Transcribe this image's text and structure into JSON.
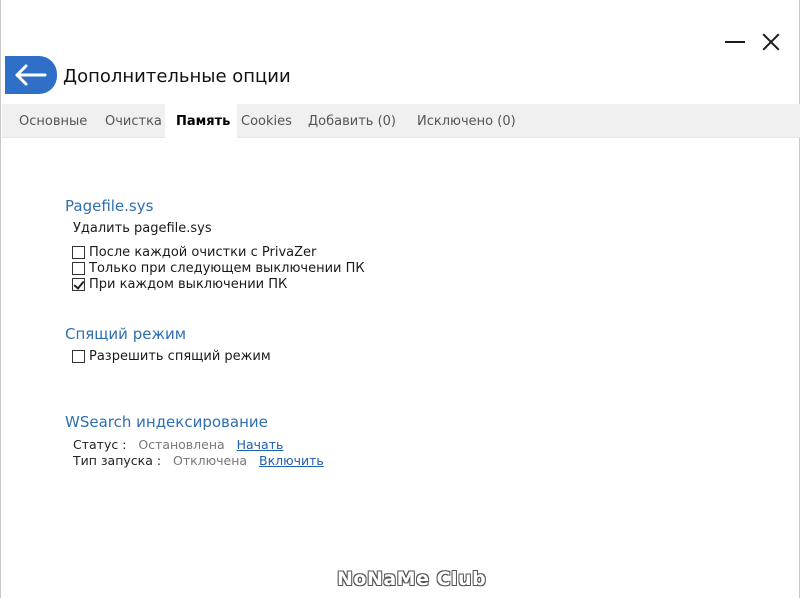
{
  "header": {
    "title": "Дополнительные опции"
  },
  "tabs": [
    {
      "label": "Основные",
      "active": false
    },
    {
      "label": "Очистка",
      "active": false
    },
    {
      "label": "Память",
      "active": true
    },
    {
      "label": "Cookies",
      "active": false
    },
    {
      "label": "Добавить (0)",
      "active": false
    },
    {
      "label": "Исключено (0)",
      "active": false
    }
  ],
  "pagefile": {
    "title": "Pagefile.sys",
    "subtitle": "Удалить pagefile.sys",
    "options": [
      {
        "label": "После каждой очистки с PrivaZer",
        "checked": false
      },
      {
        "label": "Только при следующем выключении ПК",
        "checked": false
      },
      {
        "label": "При каждом выключении ПК",
        "checked": true
      }
    ]
  },
  "sleep": {
    "title": "Спящий режим",
    "options": [
      {
        "label": "Разрешить спящий режим",
        "checked": false
      }
    ]
  },
  "wsearch": {
    "title": "WSearch индексирование",
    "status_label": "Статус :",
    "status_value": "Остановлена",
    "status_action": "Начать",
    "startup_label": "Тип запуска :",
    "startup_value": "Отключена",
    "startup_action": "Включить"
  },
  "watermark": "NoNaMe Club",
  "colors": {
    "accent": "#2f6fc7",
    "section_title": "#2e6fb0",
    "tab_bar": "#f0f0f0",
    "link": "#1f5fb0"
  },
  "icons": {
    "back": "arrow-left-icon",
    "minimize": "minimize-icon",
    "close": "close-icon"
  }
}
